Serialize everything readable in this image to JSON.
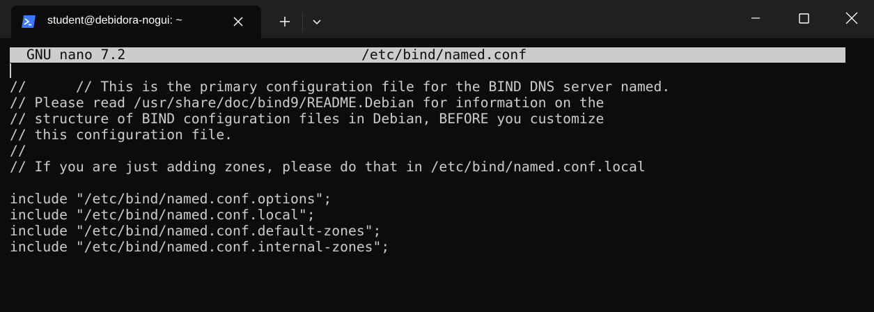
{
  "window": {
    "tab_title": "student@debidora-nogui: ~",
    "tab_icon": "powershell-icon",
    "new_tab_icon": "plus-icon",
    "dropdown_icon": "chevron-down-icon",
    "controls": [
      "minimize-icon",
      "maximize-icon",
      "close-icon"
    ]
  },
  "nano": {
    "version": "GNU nano 7.2",
    "filename": "/etc/bind/named.conf"
  },
  "editor": {
    "lines": [
      "// This is the primary configuration file for the BIND DNS server named.",
      "//",
      "// Please read /usr/share/doc/bind9/README.Debian for information on the",
      "// structure of BIND configuration files in Debian, BEFORE you customize",
      "// this configuration file.",
      "//",
      "// If you are just adding zones, please do that in /etc/bind/named.conf.local",
      "",
      "include \"/etc/bind/named.conf.options\";",
      "include \"/etc/bind/named.conf.local\";",
      "include \"/etc/bind/named.conf.default-zones\";",
      "include \"/etc/bind/named.conf.internal-zones\";"
    ]
  },
  "colors": {
    "background": "#0c0c0c",
    "titlebar": "#202020",
    "text": "#cccccc",
    "header_bg": "#cccccc",
    "accent_icon": "#3b78ff"
  }
}
